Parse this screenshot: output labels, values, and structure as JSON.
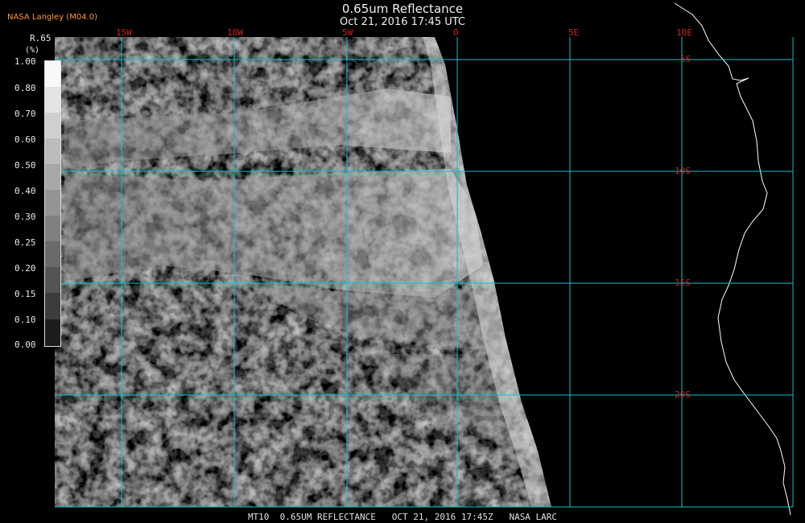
{
  "header": {
    "title": "0.65um Reflectance",
    "subtitle": "Oct 21, 2016 17:45 UTC",
    "brand": "NASA Langley (M04.0)"
  },
  "legend": {
    "variable": "R.65",
    "unit": "(%)",
    "ticks": [
      "1.00",
      "0.80",
      "0.70",
      "0.60",
      "0.50",
      "0.40",
      "0.30",
      "0.25",
      "0.20",
      "0.15",
      "0.10",
      "0.00"
    ]
  },
  "grid": {
    "lon_labels": [
      "15W",
      "10W",
      "5W",
      "0",
      "5E",
      "10E"
    ],
    "lat_labels": [
      "5S",
      "10S",
      "15S",
      "20S"
    ]
  },
  "footer": {
    "caption": "MT10  0.65UM REFLECTANCE   OCT 21, 2016 17:45Z   NASA LARC"
  },
  "colors": {
    "grid": "#00c8d0",
    "coast": "#ffffff",
    "label": "#cc2222",
    "brand": "#ff9933"
  }
}
